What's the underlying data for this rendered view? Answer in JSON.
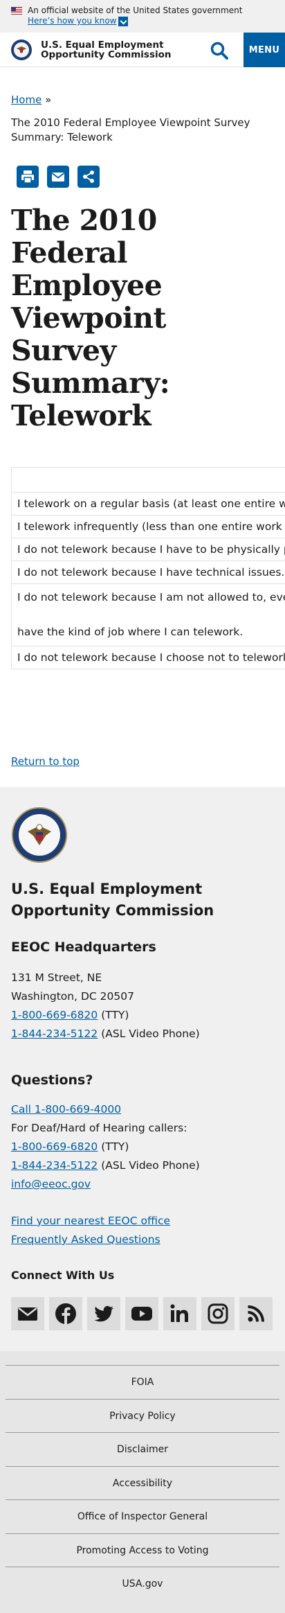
{
  "gov_banner": {
    "official_text": "An official website of the United States government",
    "how_link": "Here’s how you know"
  },
  "header": {
    "title_line1": "U.S. Equal Employment",
    "title_line2": "Opportunity Commission",
    "menu_label": "MENU"
  },
  "breadcrumb": {
    "home": "Home",
    "separator": "»",
    "current": "The 2010 Federal Employee Viewpoint Survey Summary: Telework"
  },
  "page_title": "The 2010 Federal Employee Viewpoint Survey Summary: Telework",
  "table": {
    "rows": [
      "",
      "I telework on a regular basis (at least one entire work",
      "I telework infrequently (less than one entire work day",
      "I do not telework because I have to be physically pres",
      "I do not telework because I have technical issues.",
      "I do not telework because I am not allowed to, even t",
      "have the kind of job where I can telework.",
      "I do not telework because I choose not to telework."
    ]
  },
  "return_to_top": "Return to top",
  "footer": {
    "agency_line1": "U.S. Equal Employment",
    "agency_line2": "Opportunity Commission",
    "hq_heading": "EEOC Headquarters",
    "address_line1": "131 M Street, NE",
    "address_line2": "Washington, DC 20507",
    "tty_phone": "1-800-669-6820",
    "tty_label": "(TTY)",
    "asl_phone": "1-844-234-5122",
    "asl_label": "(ASL Video Phone)",
    "questions_heading": "Questions?",
    "call_link": "Call 1-800-669-4000",
    "deaf_text": "For Deaf/Hard of Hearing callers:",
    "q_tty_phone": "1-800-669-6820",
    "q_tty_label": "(TTY)",
    "q_asl_phone": "1-844-234-5122",
    "q_asl_label": "(ASL Video Phone)",
    "email": "info@eeoc.gov",
    "find_office": "Find your nearest EEOC office",
    "faq": "Frequently Asked Questions",
    "connect_heading": "Connect With Us",
    "social_icons": [
      "email-icon",
      "facebook-icon",
      "twitter-icon",
      "youtube-icon",
      "linkedin-icon",
      "instagram-icon",
      "rss-icon"
    ],
    "links": [
      "FOIA",
      "Privacy Policy",
      "Disclaimer",
      "Accessibility",
      "Office of Inspector General",
      "Promoting Access to Voting",
      "USA.gov"
    ]
  },
  "colors": {
    "primary_blue": "#005ea2",
    "footer_bg": "#f0f0f0",
    "banner_bg": "#f0f0f0"
  }
}
